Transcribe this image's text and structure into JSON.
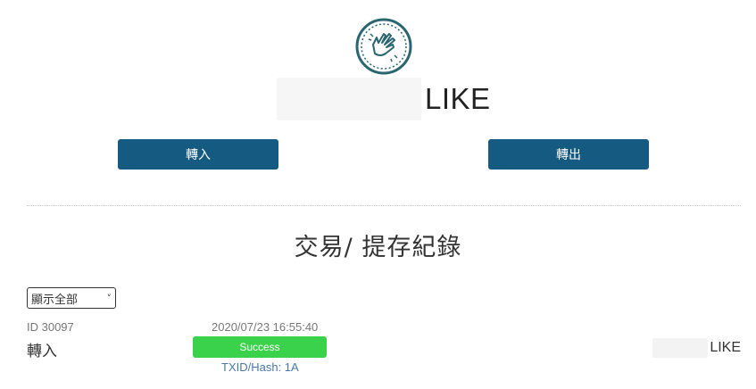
{
  "wallet": {
    "logo_icon": "clapping-hands-icon",
    "currency": "LIKE"
  },
  "actions": {
    "transfer_in_label": "轉入",
    "transfer_out_label": "轉出",
    "button_color": "#155a80"
  },
  "history": {
    "title": "交易/ 提存紀錄",
    "filter_selected": "顯示全部",
    "transactions": [
      {
        "id": "ID 30097",
        "timestamp": "2020/07/23 16:55:40",
        "type": "轉入",
        "status": "Success",
        "status_color": "#3ad24a",
        "txid": "TXID/Hash: 1A",
        "currency": "LIKE"
      }
    ]
  }
}
